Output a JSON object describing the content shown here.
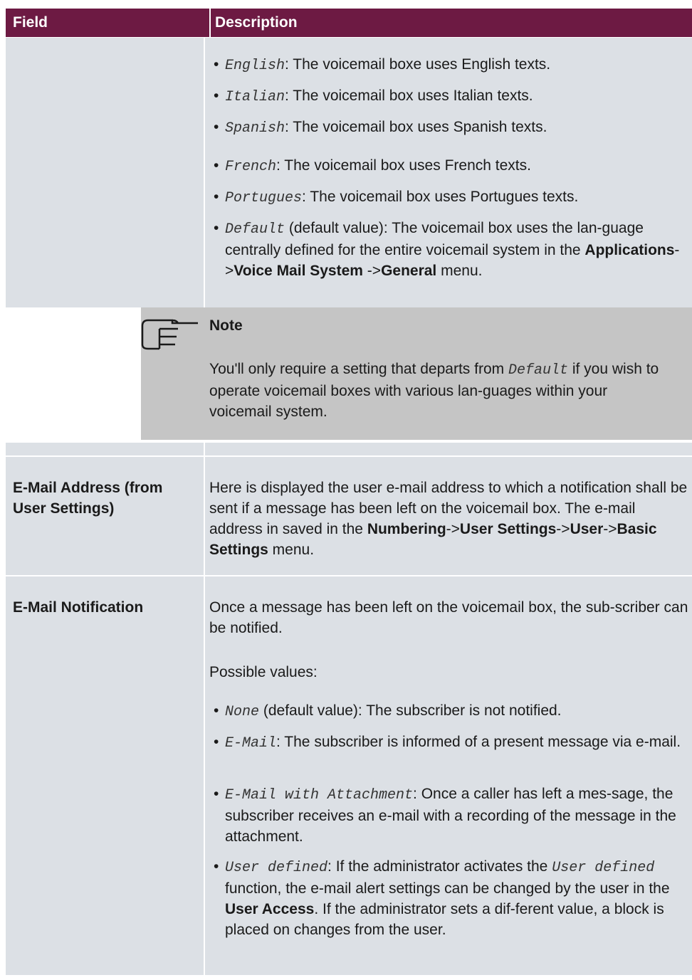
{
  "header": {
    "field": "Field",
    "description": "Description"
  },
  "languages": [
    {
      "code": "English",
      "text": ": The voicemail boxe uses English texts."
    },
    {
      "code": "Italian",
      "text": ": The voicemail box uses Italian texts."
    },
    {
      "code": "Spanish",
      "text": ": The voicemail box uses Spanish texts."
    },
    {
      "code": "French",
      "text": ": The voicemail box uses French texts."
    },
    {
      "code": "Portugues",
      "text": ": The voicemail box uses Portugues texts."
    }
  ],
  "default_item": {
    "code": "Default",
    "text_1": " (default value): The voicemail box uses the lan-guage centrally defined for the entire voicemail system in the ",
    "menu_1": "Applications",
    "sep_1": "->",
    "menu_2": "Voice Mail System",
    "sep_2": " ->",
    "menu_3": "General",
    "text_2": " menu."
  },
  "note": {
    "title": "Note",
    "text_1": "You'll only require a setting that departs from ",
    "code": "Default",
    "text_2": " if you wish to operate voicemail boxes with various lan-guages within your voicemail system."
  },
  "email_address": {
    "field": "E-Mail Address (from User Settings)",
    "text_1": "Here is displayed the user e-mail address to which a notification shall be sent if a message has been left on the voicemail box. The e-mail address in saved in the ",
    "menu_1": "Numbering",
    "sep_1": "->",
    "menu_2": "User Settings",
    "sep_2": "->",
    "menu_3": "User",
    "sep_3": "->",
    "menu_4": "Basic Settings",
    "text_2": " menu."
  },
  "email_notification": {
    "field": "E-Mail Notification",
    "intro": "Once a message has been left on the voicemail box, the sub-scriber can be notified.",
    "possible": "Possible values:",
    "items": [
      {
        "code": "None",
        "text": " (default value): The subscriber is not notified."
      },
      {
        "code": "E-Mail",
        "text": ": The subscriber is informed of a present message via e-mail."
      },
      {
        "code": "E-Mail with Attachment",
        "text": ": Once a caller has left a mes-sage, the subscriber receives an e-mail with a recording of the message in the attachment."
      }
    ],
    "user_defined": {
      "code": "User defined",
      "text_1": ": If the administrator activates the ",
      "code_2": "User defined",
      "text_2": " function, the e-mail alert settings can be changed by the user in the ",
      "menu": "User Access",
      "text_3": ". If the administrator sets a dif-ferent value, a block is placed on changes from the user."
    }
  },
  "bullet": "•"
}
